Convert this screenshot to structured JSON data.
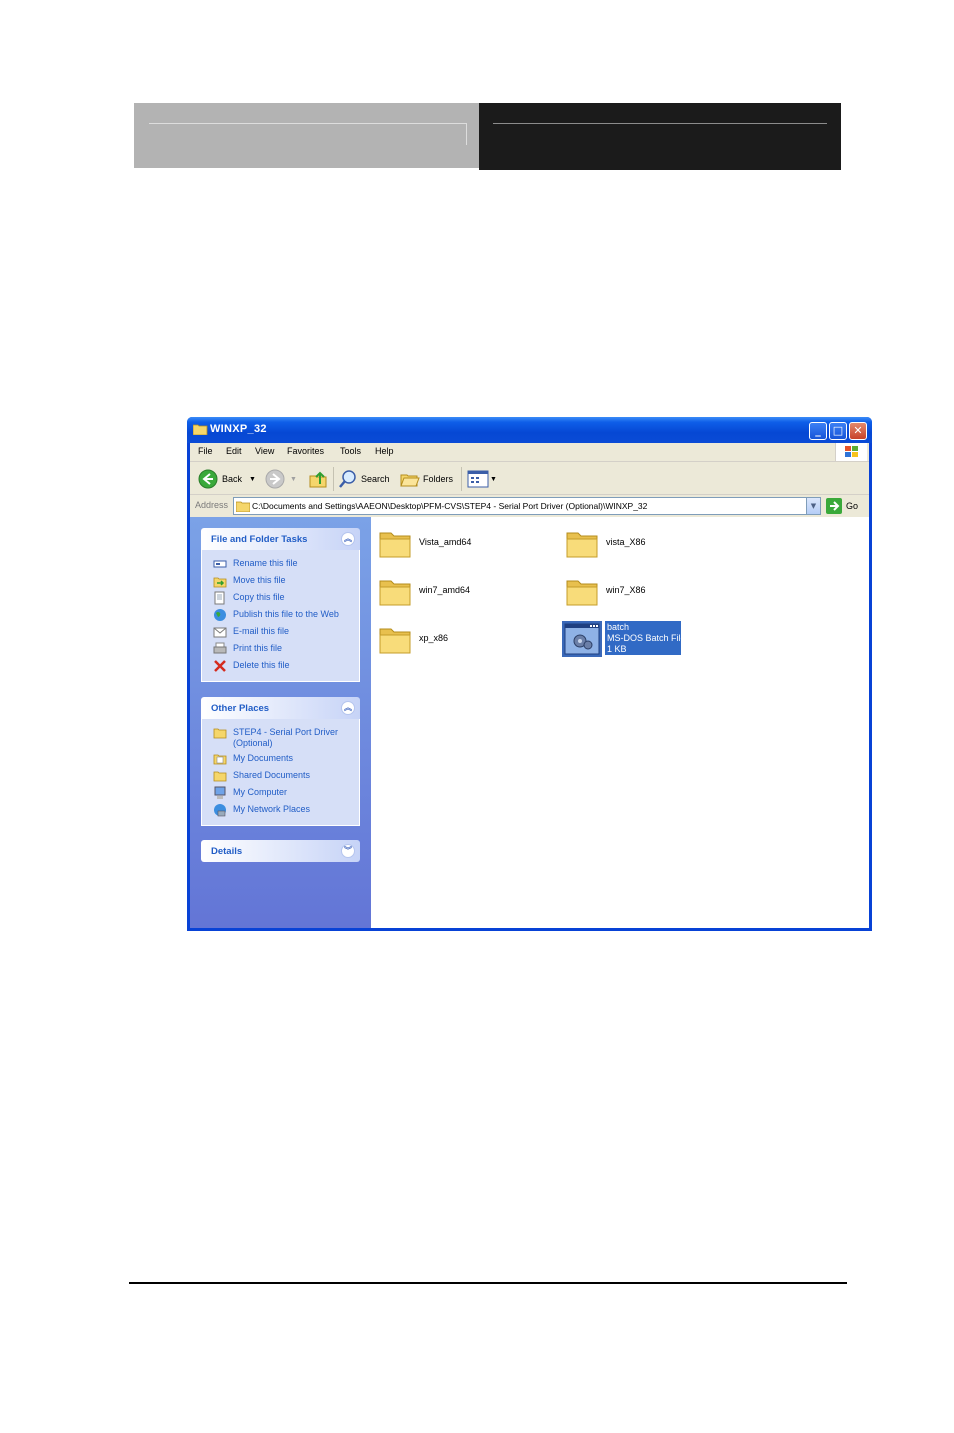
{
  "window": {
    "title": "WINXP_32",
    "minimize": "_",
    "maximize": "□",
    "close": "✕"
  },
  "menu": [
    "File",
    "Edit",
    "View",
    "Favorites",
    "Tools",
    "Help"
  ],
  "toolbar": {
    "back_label": "Back",
    "search_label": "Search",
    "folders_label": "Folders"
  },
  "address": {
    "label": "Address",
    "path": "C:\\Documents and Settings\\AAEON\\Desktop\\PFM-CVS\\STEP4 - Serial Port Driver (Optional)\\WINXP_32",
    "go_label": "Go"
  },
  "tasks_panel": {
    "title": "File and Folder Tasks",
    "items": [
      {
        "label": "Rename this file",
        "icon": "rename-icon"
      },
      {
        "label": "Move this file",
        "icon": "move-icon"
      },
      {
        "label": "Copy this file",
        "icon": "copy-icon"
      },
      {
        "label": "Publish this file to the Web",
        "icon": "globe-icon"
      },
      {
        "label": "E-mail this file",
        "icon": "email-icon"
      },
      {
        "label": "Print this file",
        "icon": "printer-icon"
      },
      {
        "label": "Delete this file",
        "icon": "delete-icon"
      }
    ]
  },
  "places_panel": {
    "title": "Other Places",
    "items": [
      {
        "label": "STEP4 - Serial Port Driver (Optional)",
        "icon": "folder-icon"
      },
      {
        "label": "My Documents",
        "icon": "my-documents-icon"
      },
      {
        "label": "Shared Documents",
        "icon": "folder-icon"
      },
      {
        "label": "My Computer",
        "icon": "my-computer-icon"
      },
      {
        "label": "My Network Places",
        "icon": "network-icon"
      }
    ]
  },
  "details_panel": {
    "title": "Details"
  },
  "files": {
    "folders": [
      "Vista_amd64",
      "vista_X86",
      "win7_amd64",
      "win7_X86",
      "xp_x86"
    ],
    "batch": {
      "name": "batch",
      "type": "MS-DOS Batch File",
      "size": "1 KB"
    }
  },
  "colors": {
    "title_bar": "#0a4bd6",
    "task_pane": "#6f8ddd",
    "link": "#215dc6",
    "selection": "#316ac5"
  }
}
